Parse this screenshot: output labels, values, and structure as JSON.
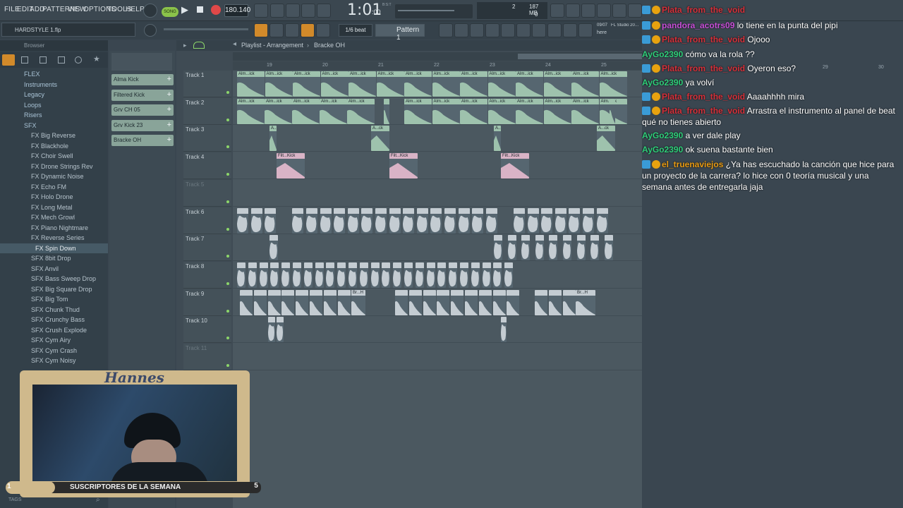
{
  "menu": [
    "FILE",
    "EDIT",
    "ADD",
    "PATTERNS",
    "VIEW",
    "OPTIONS",
    "TOOLS",
    "HELP"
  ],
  "transport": {
    "mode": "SONG",
    "tempo": "180.140",
    "time": "1:01",
    "time_sub": ":00",
    "bst": "B:S:T",
    "cpu": "2",
    "mem": "187 MB",
    "poly": "0"
  },
  "row2": {
    "project": "HARDSTYLE 1.flp",
    "snap": "1/6 beat",
    "pattern": "Pattern 1",
    "hint_date": "09/07",
    "hint_text": "FL Studio 20…",
    "hint_sub": "here"
  },
  "browser": {
    "title": "Browser",
    "items": [
      {
        "label": "FLEX",
        "type": "folder",
        "indent": 1
      },
      {
        "label": "Instruments",
        "type": "folder",
        "indent": 1
      },
      {
        "label": "Legacy",
        "type": "folder",
        "indent": 1
      },
      {
        "label": "Loops",
        "type": "folder",
        "indent": 1
      },
      {
        "label": "Risers",
        "type": "folder",
        "indent": 1
      },
      {
        "label": "SFX",
        "type": "folder",
        "indent": 1
      },
      {
        "label": "FX Big Reverse",
        "type": "file",
        "indent": 2
      },
      {
        "label": "FX Blackhole",
        "type": "file",
        "indent": 2
      },
      {
        "label": "FX Choir Swell",
        "type": "file",
        "indent": 2
      },
      {
        "label": "FX Drone Strings Rev",
        "type": "file",
        "indent": 2
      },
      {
        "label": "FX Dynamic Noise",
        "type": "file",
        "indent": 2
      },
      {
        "label": "FX Echo FM",
        "type": "file",
        "indent": 2
      },
      {
        "label": "FX Holo Drone",
        "type": "file",
        "indent": 2
      },
      {
        "label": "FX Long Metal",
        "type": "file",
        "indent": 2
      },
      {
        "label": "FX Mech Growl",
        "type": "file",
        "indent": 2
      },
      {
        "label": "FX Piano Nightmare",
        "type": "file",
        "indent": 2
      },
      {
        "label": "FX Reverse Series",
        "type": "file",
        "indent": 2
      },
      {
        "label": "FX Spin Down",
        "type": "file",
        "indent": 3,
        "selected": true
      },
      {
        "label": "SFX 8bit Drop",
        "type": "file",
        "indent": 2
      },
      {
        "label": "SFX Anvil",
        "type": "file",
        "indent": 2
      },
      {
        "label": "SFX Bass Sweep Drop",
        "type": "file",
        "indent": 2
      },
      {
        "label": "SFX Big Square Drop",
        "type": "file",
        "indent": 2
      },
      {
        "label": "SFX Big Tom",
        "type": "file",
        "indent": 2
      },
      {
        "label": "SFX Chunk Thud",
        "type": "file",
        "indent": 2
      },
      {
        "label": "SFX Crunchy Bass",
        "type": "file",
        "indent": 2
      },
      {
        "label": "SFX Crush Explode",
        "type": "file",
        "indent": 2
      },
      {
        "label": "SFX Cym Airy",
        "type": "file",
        "indent": 2
      },
      {
        "label": "SFX Cym Crash",
        "type": "file",
        "indent": 2
      },
      {
        "label": "SFX Cym Noisy",
        "type": "file",
        "indent": 2
      }
    ],
    "tags_label": "TAGS"
  },
  "channels": [
    "Alma Kick",
    "Filtered Kick",
    "Grv CH 05",
    "Grv Kick 23",
    "Bracke OH"
  ],
  "playlist": {
    "title": "Playlist - Arrangement",
    "pattern": "Bracke OH",
    "bars": [
      "19",
      "20",
      "21",
      "22",
      "23",
      "24",
      "25"
    ],
    "tracks": [
      "Track 1",
      "Track 2",
      "Track 3",
      "Track 4",
      "Track 5",
      "Track 6",
      "Track 7",
      "Track 8",
      "Track 9",
      "Track 10",
      "Track 11"
    ],
    "clip_labels": {
      "t1": "Alm...ick",
      "t2": "Alm...ick",
      "t3": "A...ck",
      "t4": "Filt...Kick",
      "t9": "Br...H"
    },
    "colors": {
      "green": "#9ec2ad",
      "pink": "#d9b3c6",
      "gray": "#c4ccd2"
    }
  },
  "chat": [
    {
      "user": "Plata_from_the_void",
      "text": "",
      "color": "#d6303a"
    },
    {
      "user": "pandora_acotrs09",
      "text": "lo tiene en la punta del pipi",
      "color": "#c84fd8"
    },
    {
      "user": "Plata_from_the_void",
      "text": "Ojooo",
      "color": "#d6303a"
    },
    {
      "user": "AyGo2390",
      "text": "cómo va la rola ??",
      "color": "#2fcf7a"
    },
    {
      "user": "Plata_from_the_void",
      "text": "Oyeron eso?",
      "color": "#d6303a"
    },
    {
      "user": "AyGo2390",
      "text": "ya volví",
      "color": "#2fcf7a"
    },
    {
      "user": "Plata_from_the_void",
      "text": "Aaaahhhh mira",
      "color": "#d6303a"
    },
    {
      "user": "Plata_from_the_void",
      "text": "Arrastra el instrumento al panel de beat qué no tienes abierto",
      "color": "#d6303a"
    },
    {
      "user": "AyGo2390",
      "text": "a ver dale play",
      "color": "#2fcf7a"
    },
    {
      "user": "AyGo2390",
      "text": "ok suena bastante bien",
      "color": "#2fcf7a"
    },
    {
      "user": "el_truenaviejos",
      "text": "¿Ya has escuchado la canción que hice para un proyecto de la carrera? lo hice con 0 teoría musical y una semana antes de entregarla jaja",
      "color": "#e89a12"
    }
  ],
  "overlay": {
    "name": "Hannes",
    "banner": "SUSCRIPTORES DE LA SEMANA",
    "left_num": "1",
    "right_num": "5",
    "chat_bars": [
      "29",
      "30"
    ]
  }
}
